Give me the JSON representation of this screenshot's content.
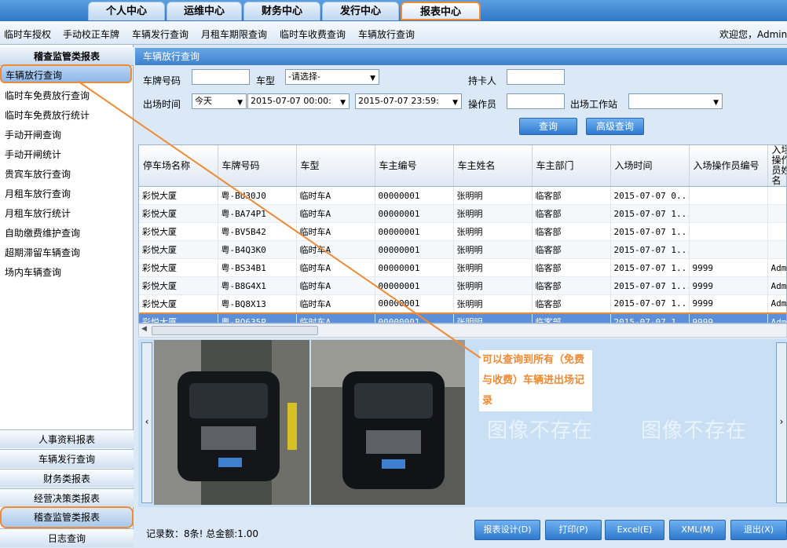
{
  "top_tabs": [
    "个人中心",
    "运维中心",
    "财务中心",
    "发行中心",
    "报表中心"
  ],
  "submenu": [
    "临时车授权",
    "手动校正车牌",
    "车辆发行查询",
    "月租车期限查询",
    "临时车收费查询",
    "车辆放行查询"
  ],
  "welcome": "欢迎您，Admin!",
  "left": {
    "header": "稽查监管类报表",
    "items": [
      "车辆放行查询",
      "临时车免费放行查询",
      "临时车免费放行统计",
      "手动开闸查询",
      "手动开闸统计",
      "贵宾车放行查询",
      "月租车放行查询",
      "月租车放行统计",
      "自助缴费维护查询",
      "超期滞留车辆查询",
      "场内车辆查询"
    ],
    "bottom": [
      "人事资料报表",
      "车辆发行查询",
      "财务类报表",
      "经营决策类报表",
      "稽查监管类报表",
      "日志查询"
    ]
  },
  "main": {
    "title": "车辆放行查询",
    "form": {
      "plate_label": "车牌号码",
      "plate_value": "",
      "type_label": "车型",
      "type_value": "-请选择-",
      "card_label": "持卡人",
      "card_value": "",
      "time_label": "出场时间",
      "period_value": "今天",
      "start_time": "2015-07-07 00:00:",
      "end_time": "2015-07-07 23:59:",
      "operator_label": "操作员",
      "operator_value": "",
      "station_label": "出场工作站",
      "station_value": "",
      "query_btn": "查询",
      "advanced_btn": "高级查询"
    },
    "table": {
      "headers": [
        "停车场名称",
        "车牌号码",
        "车型",
        "车主编号",
        "车主姓名",
        "车主部门",
        "入场时间",
        "入场操作员编号",
        "入场操作员姓名"
      ],
      "rows": [
        [
          "彩悦大厦",
          "粤-BU30J0",
          "临时车A",
          "00000001",
          "张明明",
          "临客部",
          "2015-07-07 0...",
          "",
          ""
        ],
        [
          "彩悦大厦",
          "粤-BA74P1",
          "临时车A",
          "00000001",
          "张明明",
          "临客部",
          "2015-07-07 1...",
          "",
          ""
        ],
        [
          "彩悦大厦",
          "粤-BV5B42",
          "临时车A",
          "00000001",
          "张明明",
          "临客部",
          "2015-07-07 1...",
          "",
          ""
        ],
        [
          "彩悦大厦",
          "粤-B4Q3K0",
          "临时车A",
          "00000001",
          "张明明",
          "临客部",
          "2015-07-07 1...",
          "",
          ""
        ],
        [
          "彩悦大厦",
          "粤-BS34B1",
          "临时车A",
          "00000001",
          "张明明",
          "临客部",
          "2015-07-07 1...",
          "9999",
          "Admi"
        ],
        [
          "彩悦大厦",
          "粤-B8G4X1",
          "临时车A",
          "00000001",
          "张明明",
          "临客部",
          "2015-07-07 1...",
          "9999",
          "Admi"
        ],
        [
          "彩悦大厦",
          "粤-BQ8X13",
          "临时车A",
          "00000001",
          "张明明",
          "临客部",
          "2015-07-07 1...",
          "9999",
          "Admi"
        ],
        [
          "彩悦大厦",
          "粤-BQ635P",
          "临时车A",
          "00000001",
          "张明明",
          "临客部",
          "2015-07-07 1...",
          "9999",
          "Admi"
        ]
      ]
    },
    "no_image_1": "图像不存在",
    "no_image_2": "图像不存在",
    "annotation": "可以查询到所有（免费与收费）车辆进出场记录",
    "status": "记录数：8条!  总金额:1.00",
    "buttons": [
      "报表设计(D)",
      "打印(P)",
      "Excel(E)",
      "XML(M)",
      "退出(X)"
    ]
  },
  "colors": {
    "accent": "#f08a35",
    "header_blue": "#3d82cf",
    "selected_row": "#5b8fd9"
  }
}
